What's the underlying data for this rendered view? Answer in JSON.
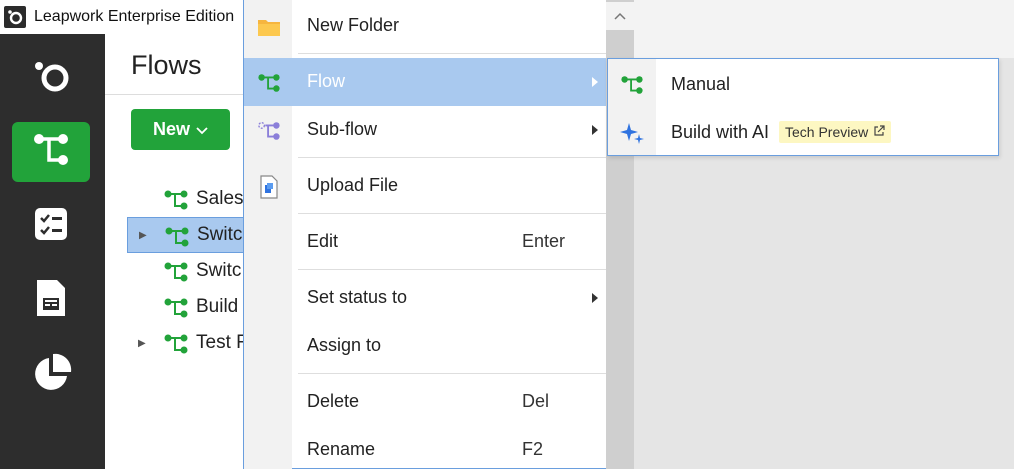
{
  "app": {
    "title": "Leapwork Enterprise Edition"
  },
  "colors": {
    "accent_green": "#22a33a",
    "sidebar_bg": "#2d2d2d",
    "highlight": "#a9c9ef",
    "ai_blue": "#2f73e0",
    "subflow_purple": "#8b7fd9"
  },
  "sidebar": {
    "items": [
      {
        "icon": "leapwork-logo-icon"
      },
      {
        "icon": "flow-icon",
        "active": true
      },
      {
        "icon": "checklist-icon"
      },
      {
        "icon": "report-icon"
      },
      {
        "icon": "pie-chart-icon"
      }
    ]
  },
  "flows_panel": {
    "title": "Flows",
    "new_button": "New",
    "tree": [
      {
        "label": "Sales",
        "expandable": false,
        "selected": false
      },
      {
        "label": "Switc",
        "expandable": true,
        "selected": true
      },
      {
        "label": "Switc",
        "expandable": false,
        "selected": false
      },
      {
        "label": "Build",
        "expandable": false,
        "selected": false
      },
      {
        "label": "Test F",
        "expandable": true,
        "selected": false
      }
    ]
  },
  "context_menu": {
    "items": [
      {
        "label": "New Folder",
        "icon": "folder-icon"
      },
      {
        "label": "Flow",
        "icon": "flow-icon",
        "submenu": true,
        "highlighted": true
      },
      {
        "label": "Sub-flow",
        "icon": "subflow-icon",
        "submenu": true
      },
      {
        "label": "Upload File",
        "icon": "upload-file-icon"
      },
      {
        "label": "Edit",
        "shortcut": "Enter"
      },
      {
        "label": "Set status to",
        "submenu": true
      },
      {
        "label": "Assign to"
      },
      {
        "label": "Delete",
        "shortcut": "Del"
      },
      {
        "label": "Rename",
        "shortcut": "F2"
      }
    ]
  },
  "submenu": {
    "items": [
      {
        "label": "Manual",
        "icon": "flow-icon"
      },
      {
        "label": "Build with AI",
        "icon": "ai-sparkle-icon",
        "badge": "Tech Preview"
      }
    ]
  }
}
